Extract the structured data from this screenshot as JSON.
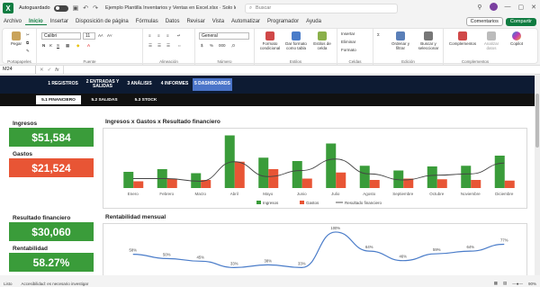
{
  "titlebar": {
    "logo": "X",
    "autosave": "Autoguardado",
    "doc_title": "Ejemplo Plantilla Inventarios y Ventas en Excel.xlsx · Solo lec...",
    "search_placeholder": "Buscar"
  },
  "menu": [
    "Archivo",
    "Inicio",
    "Insertar",
    "Disposición de página",
    "Fórmulas",
    "Datos",
    "Revisar",
    "Vista",
    "Automatizar",
    "Programador",
    "Ayuda"
  ],
  "menu_active": "Inicio",
  "buttons": {
    "comments": "Comentarios",
    "share": "Compartir"
  },
  "ribbon": {
    "groups": [
      "Portapapeles",
      "Fuente",
      "Alineación",
      "Número",
      "Estilos",
      "Celdas",
      "Edición",
      "Complementos"
    ],
    "paste": "Pegar",
    "font_name": "Calibri",
    "font_size": "11",
    "number_format": "General",
    "cond_format": "Formato condicional",
    "table_format": "Dar formato como tabla",
    "cell_styles": "Estilos de celda",
    "insert": "Insertar",
    "delete": "Eliminar",
    "format": "Formato",
    "sort": "Ordenar y filtrar",
    "find": "Buscar y seleccionar",
    "addins": "Complementos",
    "data_analysis": "Analizar datos",
    "copilot": "Copilot"
  },
  "formula": {
    "cell": "M24",
    "fx": "fx"
  },
  "nav": {
    "tabs": [
      "1 REGISTROS",
      "2 ENTRADAS Y SALIDAS",
      "3 ANÁLISIS",
      "4 INFORMES",
      "5 DASHBOARDS"
    ],
    "active": 4,
    "subtabs": [
      "5.1 FINANCIERO",
      "5.2 SALIDAS",
      "5.3 STOCK"
    ],
    "sub_active": 0
  },
  "kpis": [
    {
      "label": "Ingresos",
      "value": "$51,584",
      "color": "green"
    },
    {
      "label": "Gastos",
      "value": "$21,524",
      "color": "red"
    },
    {
      "label": "Resultado financiero",
      "value": "$30,060",
      "color": "green"
    },
    {
      "label": "Rentabilidad",
      "value": "58.27%",
      "color": "green"
    }
  ],
  "colors": {
    "green": "#3a9c3a",
    "red": "#e85535",
    "navy": "#0d1b33",
    "accent": "#107c41",
    "line": "#4a7cc9"
  },
  "chart_data": [
    {
      "type": "bar",
      "title": "Ingresos x Gastos x Resultado financiero",
      "categories": [
        "Enero",
        "Febrero",
        "Marzo",
        "Abril",
        "Mayo",
        "Junio",
        "Julio",
        "Agosto",
        "Septiembre",
        "Octubre",
        "Noviembre",
        "Diciembre"
      ],
      "series": [
        {
          "name": "Ingresos",
          "values": [
            2400,
            2800,
            2200,
            7800,
            4500,
            4000,
            6600,
            3300,
            2600,
            3200,
            3300,
            4800
          ]
        },
        {
          "name": "Gastos",
          "values": [
            1000,
            1400,
            1200,
            3900,
            2800,
            1400,
            2300,
            1200,
            1400,
            1300,
            1200,
            1100
          ]
        },
        {
          "name": "Resultado financiero",
          "values": [
            1400,
            1400,
            1000,
            3900,
            1700,
            2600,
            4300,
            2100,
            1200,
            1900,
            2100,
            3700
          ]
        }
      ],
      "data_labels": [
        "",
        "",
        "",
        "",
        "",
        "",
        "",
        "",
        "",
        "",
        "",
        ""
      ],
      "legend": "bottom",
      "grid": false
    },
    {
      "type": "line",
      "title": "Rentabilidad mensual",
      "categories": [
        "Enero",
        "Febrero",
        "Marzo",
        "Abril",
        "Mayo",
        "Junio",
        "Julio",
        "Agosto",
        "Septiembre",
        "Octubre",
        "Noviembre",
        "Diciembre"
      ],
      "series": [
        {
          "name": "Rentabilidad",
          "values": [
            58,
            50,
            45,
            33,
            38,
            33,
            100,
            64,
            46,
            59,
            64,
            77
          ]
        }
      ],
      "data_labels": [
        "58%",
        "50%",
        "45%",
        "33%",
        "38%",
        "33%",
        "100%",
        "64%",
        "46%",
        "59%",
        "64%",
        "77%"
      ],
      "legend": "none",
      "grid": false
    }
  ],
  "status": {
    "ready": "Listo",
    "accessibility": "Accesibilidad: es necesario investigar",
    "zoom": "90%"
  }
}
